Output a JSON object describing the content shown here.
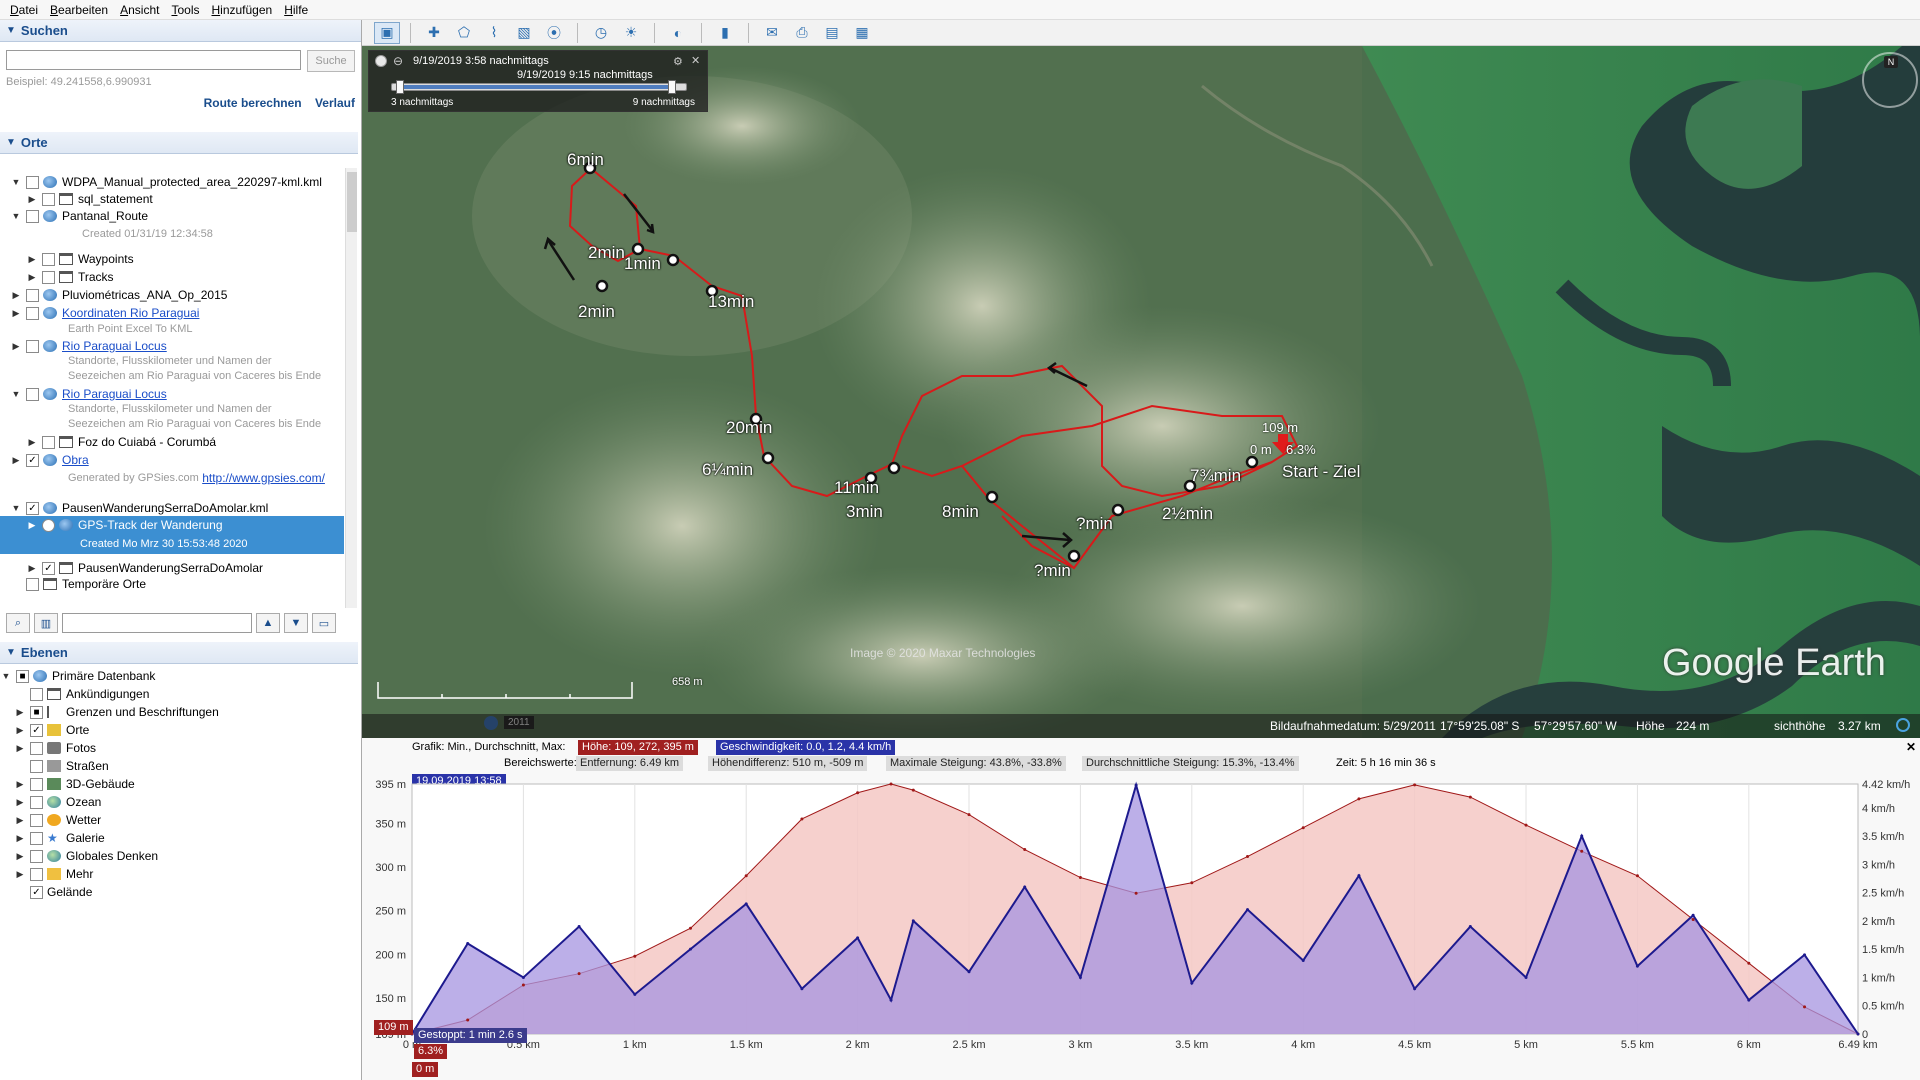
{
  "menu": [
    "Datei",
    "Bearbeiten",
    "Ansicht",
    "Tools",
    "Hinzufügen",
    "Hilfe"
  ],
  "search": {
    "title": "Suchen",
    "placeholder": "",
    "button": "Suche",
    "hint": "Beispiel: 49.241558,6.990931",
    "route_link": "Route berechnen",
    "history_link": "Verlauf"
  },
  "places": {
    "title": "Orte",
    "items": [
      {
        "label": "WDPA_Manual_protected_area_220297-kml.kml"
      },
      {
        "label": "sql_statement"
      },
      {
        "label": "Pantanal_Route"
      },
      {
        "label": "Created 01/31/19 12:34:58"
      },
      {
        "label": "Waypoints"
      },
      {
        "label": "Tracks"
      },
      {
        "label": "Pluviométricas_ANA_Op_2015"
      },
      {
        "label": "Koordinaten Rio Paraguai"
      },
      {
        "label": "Earth Point Excel To KML"
      },
      {
        "label": "Rio Paraguai Locus"
      },
      {
        "label": "Standorte, Flusskilometer und Namen der"
      },
      {
        "label": "Seezeichen am Rio Paraguai von Caceres bis Ende"
      },
      {
        "label": "Rio Paraguai Locus"
      },
      {
        "label": "Standorte, Flusskilometer und Namen der"
      },
      {
        "label": "Seezeichen am Rio Paraguai von Caceres bis Ende"
      },
      {
        "label": "Foz do Cuiabá - Corumbá"
      },
      {
        "label": "Obra"
      },
      {
        "label": "Generated by GPSies.com"
      },
      {
        "label": "http://www.gpsies.com/"
      },
      {
        "label": "PausenWanderungSerraDoAmolar.kml"
      },
      {
        "label": "GPS-Track der Wanderung"
      },
      {
        "label": "Created Mo Mrz 30 15:53:48 2020"
      },
      {
        "label": "PausenWanderungSerraDoAmolar"
      },
      {
        "label": "Temporäre Orte"
      }
    ]
  },
  "layers": {
    "title": "Ebenen",
    "items": [
      {
        "label": "Primäre Datenbank"
      },
      {
        "label": "Ankündigungen"
      },
      {
        "label": "Grenzen und Beschriftungen"
      },
      {
        "label": "Orte"
      },
      {
        "label": "Fotos"
      },
      {
        "label": "Straßen"
      },
      {
        "label": "3D-Gebäude"
      },
      {
        "label": "Ozean"
      },
      {
        "label": "Wetter"
      },
      {
        "label": "Galerie"
      },
      {
        "label": "Globales Denken"
      },
      {
        "label": "Mehr"
      },
      {
        "label": "Gelände"
      }
    ]
  },
  "time": {
    "start": "9/19/2019   3:58 nachmittags",
    "end": "9/19/2019   9:15 nachmittags",
    "left_label": "3 nachmittags",
    "right_label": "9 nachmittags"
  },
  "map": {
    "markers": [
      {
        "label": "6min"
      },
      {
        "label": "2min"
      },
      {
        "label": "1min"
      },
      {
        "label": "2min"
      },
      {
        "label": "13min"
      },
      {
        "label": "20min"
      },
      {
        "label": "6¼min"
      },
      {
        "label": "11min"
      },
      {
        "label": "3min"
      },
      {
        "label": "8min"
      },
      {
        "label": "?min"
      },
      {
        "label": "?min"
      },
      {
        "label": "2½min"
      },
      {
        "label": "7¾min"
      }
    ],
    "start_height": "109 m",
    "start_dist": "0 m",
    "start_grade": "6.3%",
    "start_label": "Start - Ziel",
    "copyright": "Image © 2020 Maxar Technologies",
    "brand": "Google Earth",
    "scale": "658 m",
    "year": "2011",
    "compass": "N"
  },
  "status": {
    "date": "Bildaufnahmedatum: 5/29/2011",
    "lat": "17°59'25.08\" S",
    "lon": "57°29'57.60\" W",
    "height_label": "Höhe",
    "height": "224 m",
    "eye_label": "sichthöhe",
    "eye": "3.27 km"
  },
  "profile": {
    "graph_label": "Grafik: Min., Durchschnitt, Max:",
    "height_stats": "Höhe: 109, 272, 395 m",
    "speed_stats": "Geschwindigkeit: 0.0, 1.2, 4.4 km/h",
    "range_label": "Bereichswerte:",
    "distance": "Entfernung: 6.49 km",
    "diff": "Höhendifferenz: 510 m, -509 m",
    "max_slope": "Maximale Steigung: 43.8%, -33.8%",
    "avg_slope": "Durchschnittliche Steigung: 15.3%, -13.4%",
    "duration": "Zeit: 5 h 16 min 36 s",
    "timestamp": "19.09.2019 13:58",
    "cursor_height": "109 m",
    "cursor_dist": "0 m",
    "cursor_grade": "6.3%",
    "stopped": "Gestoppt: 1 min 2.6 s",
    "close": "✕"
  },
  "chart_data": {
    "type": "area",
    "x": [
      0,
      0.25,
      0.5,
      0.75,
      1.0,
      1.25,
      1.5,
      1.75,
      2.0,
      2.15,
      2.25,
      2.5,
      2.75,
      3.0,
      3.25,
      3.5,
      3.75,
      4.0,
      4.25,
      4.5,
      4.75,
      5.0,
      5.25,
      5.5,
      5.75,
      6.0,
      6.25,
      6.49
    ],
    "series": [
      {
        "axis": "left",
        "values": [
          109,
          125,
          165,
          178,
          198,
          230,
          290,
          355,
          385,
          395,
          388,
          360,
          320,
          288,
          270,
          282,
          312,
          345,
          378,
          394,
          380,
          348,
          318,
          290,
          240,
          190,
          140,
          109
        ]
      },
      {
        "axis": "right",
        "values": [
          0.0,
          1.6,
          1.0,
          1.9,
          0.7,
          1.5,
          2.3,
          0.8,
          1.7,
          0.6,
          2.0,
          1.1,
          2.6,
          1.0,
          4.4,
          0.9,
          2.2,
          1.3,
          2.8,
          0.8,
          1.9,
          1.0,
          3.5,
          1.2,
          2.1,
          0.6,
          1.4,
          0.0
        ]
      }
    ],
    "xlabel": "",
    "ylim_left": [
      109,
      395
    ],
    "ylim_right": [
      0,
      4.42
    ],
    "x_ticks": [
      "0 m",
      "0.5 km",
      "1 km",
      "1.5 km",
      "2 km",
      "2.5 km",
      "3 km",
      "3.5 km",
      "4 km",
      "4.5 km",
      "5 km",
      "5.5 km",
      "6 km",
      "6.49 km"
    ],
    "y_ticks_left": [
      "395 m",
      "350 m",
      "300 m",
      "250 m",
      "200 m",
      "150 m",
      "109 m"
    ],
    "y_ticks_right": [
      "4.42 km/h",
      "4 km/h",
      "3.5 km/h",
      "3 km/h",
      "2.5 km/h",
      "2 km/h",
      "1.5 km/h",
      "1 km/h",
      "0.5 km/h",
      "0"
    ],
    "colors": {
      "height_fill": "#f4c8c4",
      "height_line": "#a01818",
      "speed_fill": "#a594e0",
      "speed_line": "#1d1a8e"
    }
  }
}
